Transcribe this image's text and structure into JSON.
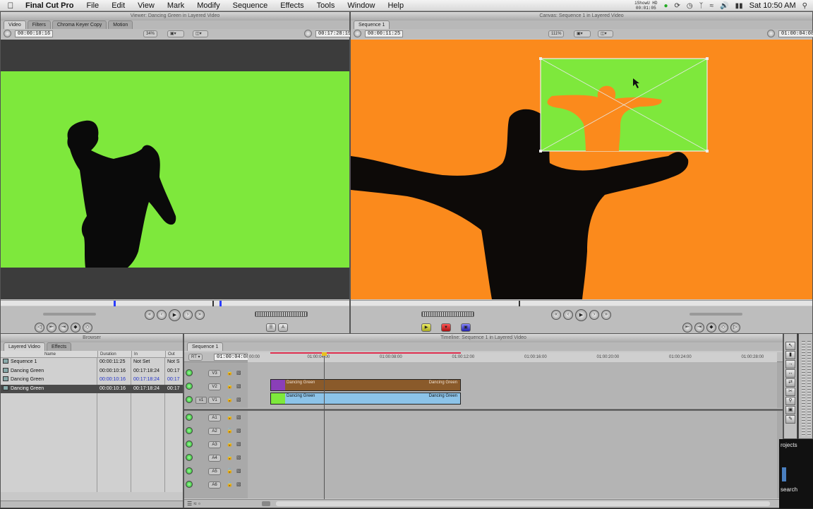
{
  "menubar": {
    "app_name": "Final Cut Pro",
    "items": [
      "File",
      "Edit",
      "View",
      "Mark",
      "Modify",
      "Sequence",
      "Effects",
      "Tools",
      "Window",
      "Help"
    ],
    "status_line1": "iShowU HD",
    "status_line2": "00:01:05",
    "clock": "Sat 10:50 AM"
  },
  "viewer": {
    "title": "Viewer: Dancing Green in Layered Video",
    "tabs": [
      "Video",
      "Filters",
      "Chroma Keyer Copy",
      "Motion"
    ],
    "duration": "00:00:10:16",
    "zoom": "34%",
    "current_tc": "00:17:28:19"
  },
  "canvas": {
    "title": "Canvas: Sequence 1 in Layered Video",
    "tab": "Sequence 1",
    "duration": "00:00:11:25",
    "zoom": "111%",
    "current_tc": "01:00:04:08"
  },
  "browser": {
    "title": "Browser",
    "tabs": [
      "Layered Video",
      "Effects"
    ],
    "columns": [
      "Name",
      "Duration",
      "In",
      "Out"
    ],
    "rows": [
      {
        "name": "Sequence 1",
        "duration": "00:00:11:25",
        "in": "Not Set",
        "out": "Not S"
      },
      {
        "name": "Dancing Green",
        "duration": "00:00:10:16",
        "in": "00:17:18:24",
        "out": "00:17"
      },
      {
        "name": "Dancing Green",
        "duration": "00:00:10:16",
        "in": "00:17:18:24",
        "out": "00:17"
      },
      {
        "name": "Dancing Green",
        "duration": "00:00:10:16",
        "in": "00:17:18:24",
        "out": "00:17"
      }
    ]
  },
  "timeline": {
    "title": "Timeline: Sequence 1 in Layered Video",
    "tab": "Sequence 1",
    "rt": "RT",
    "current_tc": "01:00:04:08",
    "ruler": [
      "00:00",
      "01:00:04:00",
      "01:00:08:00",
      "01:00:12:00",
      "01:00:16:00",
      "01:00:20:00",
      "01:00:24:00",
      "01:00:28:00"
    ],
    "video_tracks": [
      {
        "name": "V3",
        "dest": ""
      },
      {
        "name": "V2",
        "dest": ""
      },
      {
        "name": "V1",
        "dest": "v1"
      }
    ],
    "audio_tracks": [
      "A1",
      "A2",
      "A3",
      "A4",
      "A5",
      "A6"
    ],
    "clips": {
      "v2_left": "Dancing Green",
      "v2_right": "Dancing Green",
      "v1_left": "Dancing Green",
      "v1_right": "Dancing Green"
    }
  },
  "dock_labels": {
    "projects": "rojects",
    "search": "search"
  },
  "colors": {
    "green_screen": "#7ee83c",
    "orange_bg": "#fb8a1c",
    "v2_clip": "#8a5a2a",
    "v1_clip": "#8cc3e8"
  }
}
